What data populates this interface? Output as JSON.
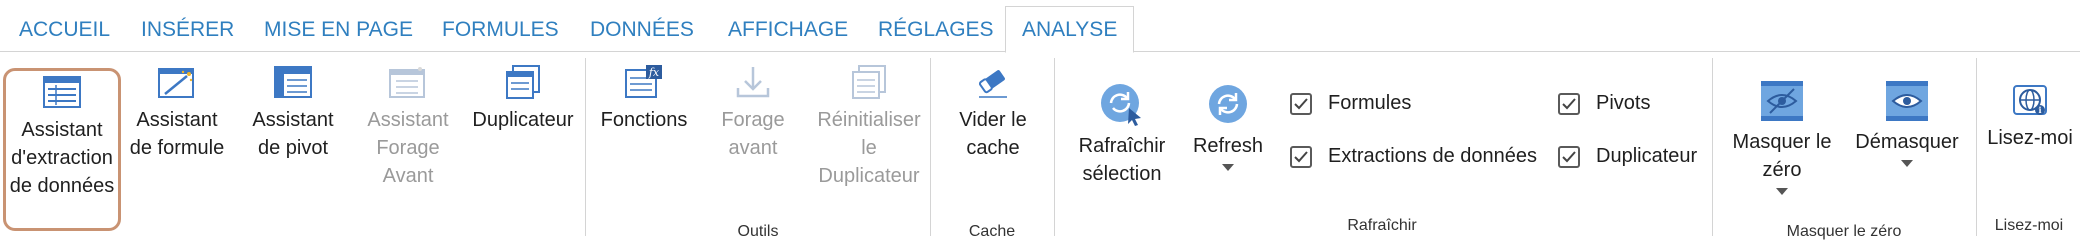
{
  "tabs": {
    "accueil": "ACCUEIL",
    "inserer": "INSÉRER",
    "mise_en_page": "MISE EN PAGE",
    "formules": "FORMULES",
    "donnees": "DONNÉES",
    "affichage": "AFFICHAGE",
    "reglages": "RÉGLAGES",
    "analyse": "ANALYSE"
  },
  "assistants": {
    "extraction_l1": "Assistant",
    "extraction_l2": "d'extraction",
    "extraction_l3": "de données",
    "formule_l1": "Assistant",
    "formule_l2": "de formule",
    "pivot_l1": "Assistant",
    "pivot_l2": "de pivot",
    "forage_l1": "Assistant",
    "forage_l2": "Forage",
    "forage_l3": "Avant",
    "duplicateur": "Duplicateur"
  },
  "outils": {
    "fonctions": "Fonctions",
    "forage_l1": "Forage",
    "forage_l2": "avant",
    "reinit_l1": "Réinitialiser",
    "reinit_l2": "le",
    "reinit_l3": "Duplicateur",
    "group_label": "Outils"
  },
  "cache": {
    "vider_l1": "Vider le",
    "vider_l2": "cache",
    "group_label": "Cache"
  },
  "rafraichir": {
    "selection_l1": "Rafraîchir",
    "selection_l2": "sélection",
    "refresh": "Refresh",
    "chk_formules": "Formules",
    "chk_extractions": "Extractions de données",
    "chk_pivots": "Pivots",
    "chk_duplicateur": "Duplicateur",
    "group_label": "Rafraîchir"
  },
  "masquer": {
    "masquer_l1": "Masquer le",
    "masquer_l2": "zéro",
    "demasquer": "Démasquer",
    "group_label": "Masquer le zéro"
  },
  "lisez": {
    "button": "Lisez-moi",
    "group_label": "Lisez-moi"
  },
  "colors": {
    "tab_text": "#2f7fbf",
    "selected_border": "#c99373",
    "icon_blue": "#3d78c4",
    "icon_light_blue": "#6fa6e0",
    "disabled": "#9a9a9a"
  }
}
